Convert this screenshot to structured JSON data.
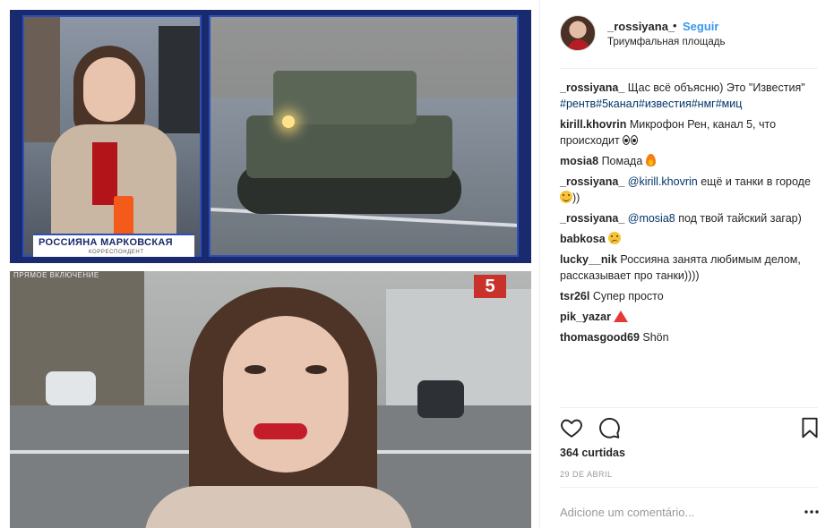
{
  "media": {
    "top_frame": {
      "lower_third_name": "РОССИЯНА МАРКОВСКАЯ",
      "lower_third_role": "КОРРЕСПОНДЕНТ"
    },
    "bottom_frame": {
      "banner_text": "ПРЯМОЕ ВКЛЮЧЕНИЕ",
      "channel_logo": "5"
    }
  },
  "header": {
    "username": "_rossiyana_",
    "dot": "•",
    "follow_label": "Seguir",
    "location": "Триумфальная площадь",
    "follow_color": "#3897f0"
  },
  "caption": {
    "user": "_rossiyana_",
    "text": " Щас всё объясню) Это \"Известия\"",
    "hashtags": "#рентв#5канал#известия#нмг#миц"
  },
  "comments": [
    {
      "user": "kirill.khovrin",
      "text": " Микрофон Рен, канал 5, что происходит ",
      "emoji": "eyes-icon"
    },
    {
      "user": "mosia8",
      "text": " Помада ",
      "emoji": "fire-icon"
    },
    {
      "user": "_rossiyana_",
      "mention": " @kirill.khovrin",
      "text": " ещё и танки в городе ",
      "text_after": "))",
      "emoji": "smile-icon"
    },
    {
      "user": "_rossiyana_",
      "mention": " @mosia8",
      "text": " под твой тайский загар)"
    },
    {
      "user": "babkosa",
      "text": " ",
      "emoji": "confused-icon"
    },
    {
      "user": "lucky__nik",
      "text": " Россияна занята любимым делом, рассказывает про танки))))"
    },
    {
      "user": "tsr26l",
      "text": " Супер просто"
    },
    {
      "user": "pik_yazar",
      "text": " ",
      "emoji": "warning-icon"
    },
    {
      "user": "thomasgood69",
      "text": " Shön"
    }
  ],
  "actions": {
    "likes": "364 curtidas",
    "date": "29 DE ABRIL",
    "add_comment_placeholder": "Adicione um comentário..."
  },
  "icons": [
    "heart-icon",
    "comment-icon",
    "bookmark-icon",
    "more-options-icon"
  ]
}
